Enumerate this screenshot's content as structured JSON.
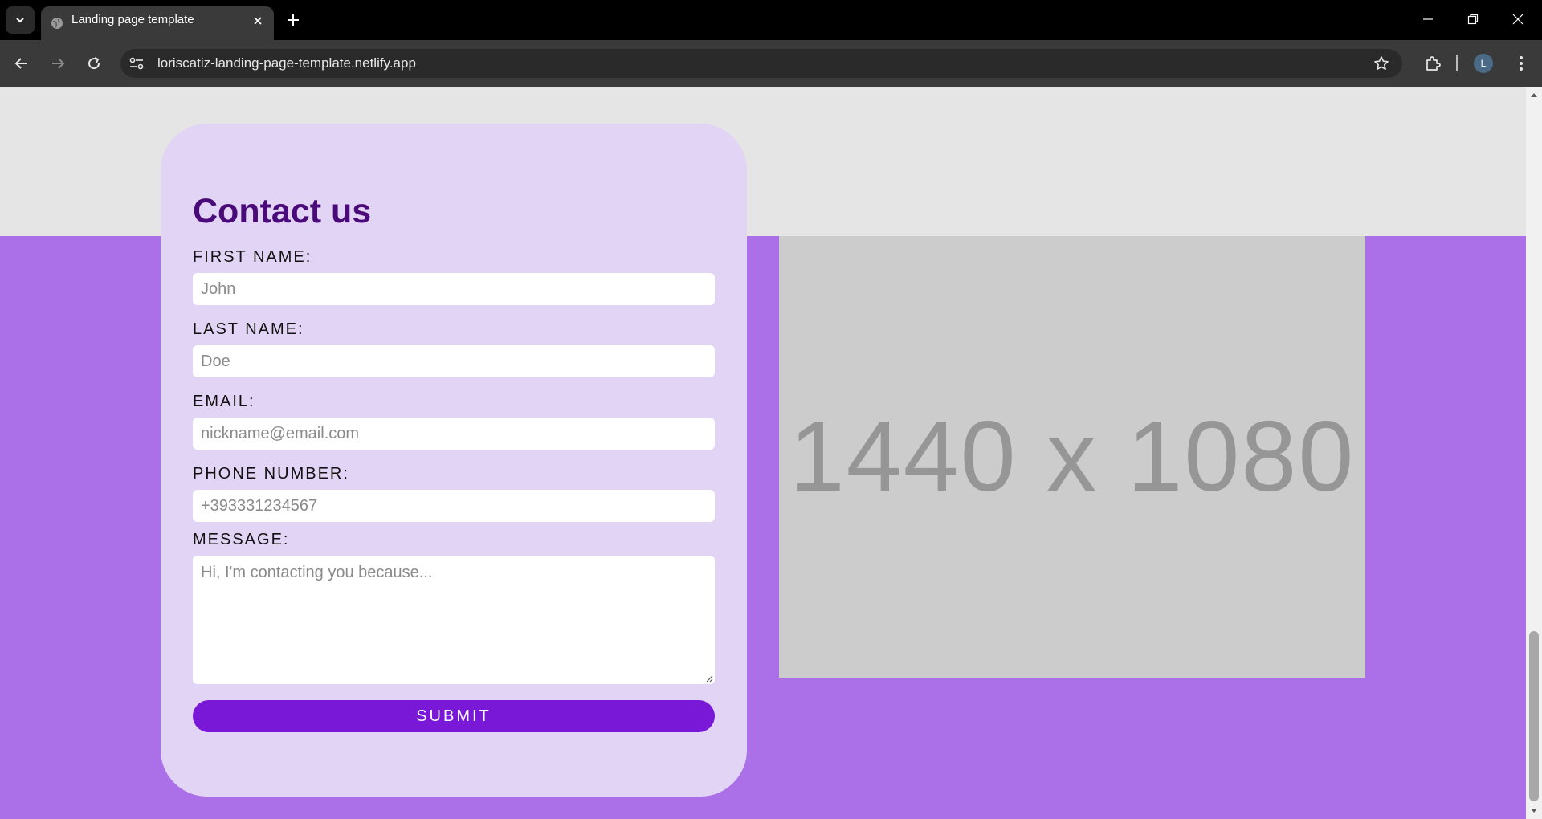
{
  "browser": {
    "tab_title": "Landing page template",
    "url": "loriscatiz-landing-page-template.netlify.app",
    "profile_initial": "L"
  },
  "contact": {
    "title": "Contact us",
    "first_name_label": "FIRST NAME:",
    "first_name_placeholder": "John",
    "last_name_label": "LAST NAME:",
    "last_name_placeholder": "Doe",
    "email_label": "EMAIL:",
    "email_placeholder": "nickname@email.com",
    "phone_label": "PHONE NUMBER:",
    "phone_placeholder": "+393331234567",
    "message_label": "MESSAGE:",
    "message_placeholder": "Hi, I'm contacting you because...",
    "submit_label": "SUBMIT"
  },
  "image_placeholder": {
    "text": "1440 x 1080"
  },
  "colors": {
    "band": "#ab70e8",
    "card": "#e2d4f4",
    "title": "#4b0a7a",
    "button": "#7a18d8",
    "placeholder": "#cccccc"
  },
  "scroll_position": 0.77
}
